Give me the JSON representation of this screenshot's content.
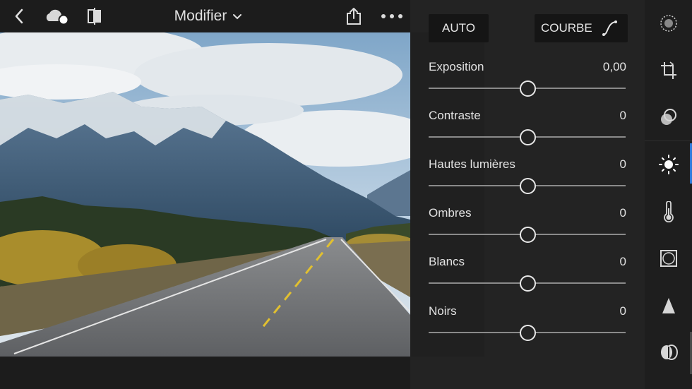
{
  "topbar": {
    "title": "Modifier",
    "icons": [
      "back-chevron-icon",
      "cloud-sync-icon",
      "compare-icon",
      "share-icon",
      "more-icon"
    ]
  },
  "panel": {
    "auto_label": "AUTO",
    "courbe_label": "COURBE",
    "sliders": [
      {
        "label": "Exposition",
        "value": "0,00",
        "position": 0.5
      },
      {
        "label": "Contraste",
        "value": "0",
        "position": 0.5
      },
      {
        "label": "Hautes lumières",
        "value": "0",
        "position": 0.5
      },
      {
        "label": "Ombres",
        "value": "0",
        "position": 0.5
      },
      {
        "label": "Blancs",
        "value": "0",
        "position": 0.5
      },
      {
        "label": "Noirs",
        "value": "0",
        "position": 0.5
      }
    ]
  },
  "rail": {
    "items": [
      "selective-icon",
      "crop-icon",
      "presets-icon",
      "light-icon",
      "color-icon",
      "effects-icon",
      "detail-icon",
      "optics-icon"
    ],
    "active": "light-icon",
    "accent": "#2f7ad9"
  }
}
